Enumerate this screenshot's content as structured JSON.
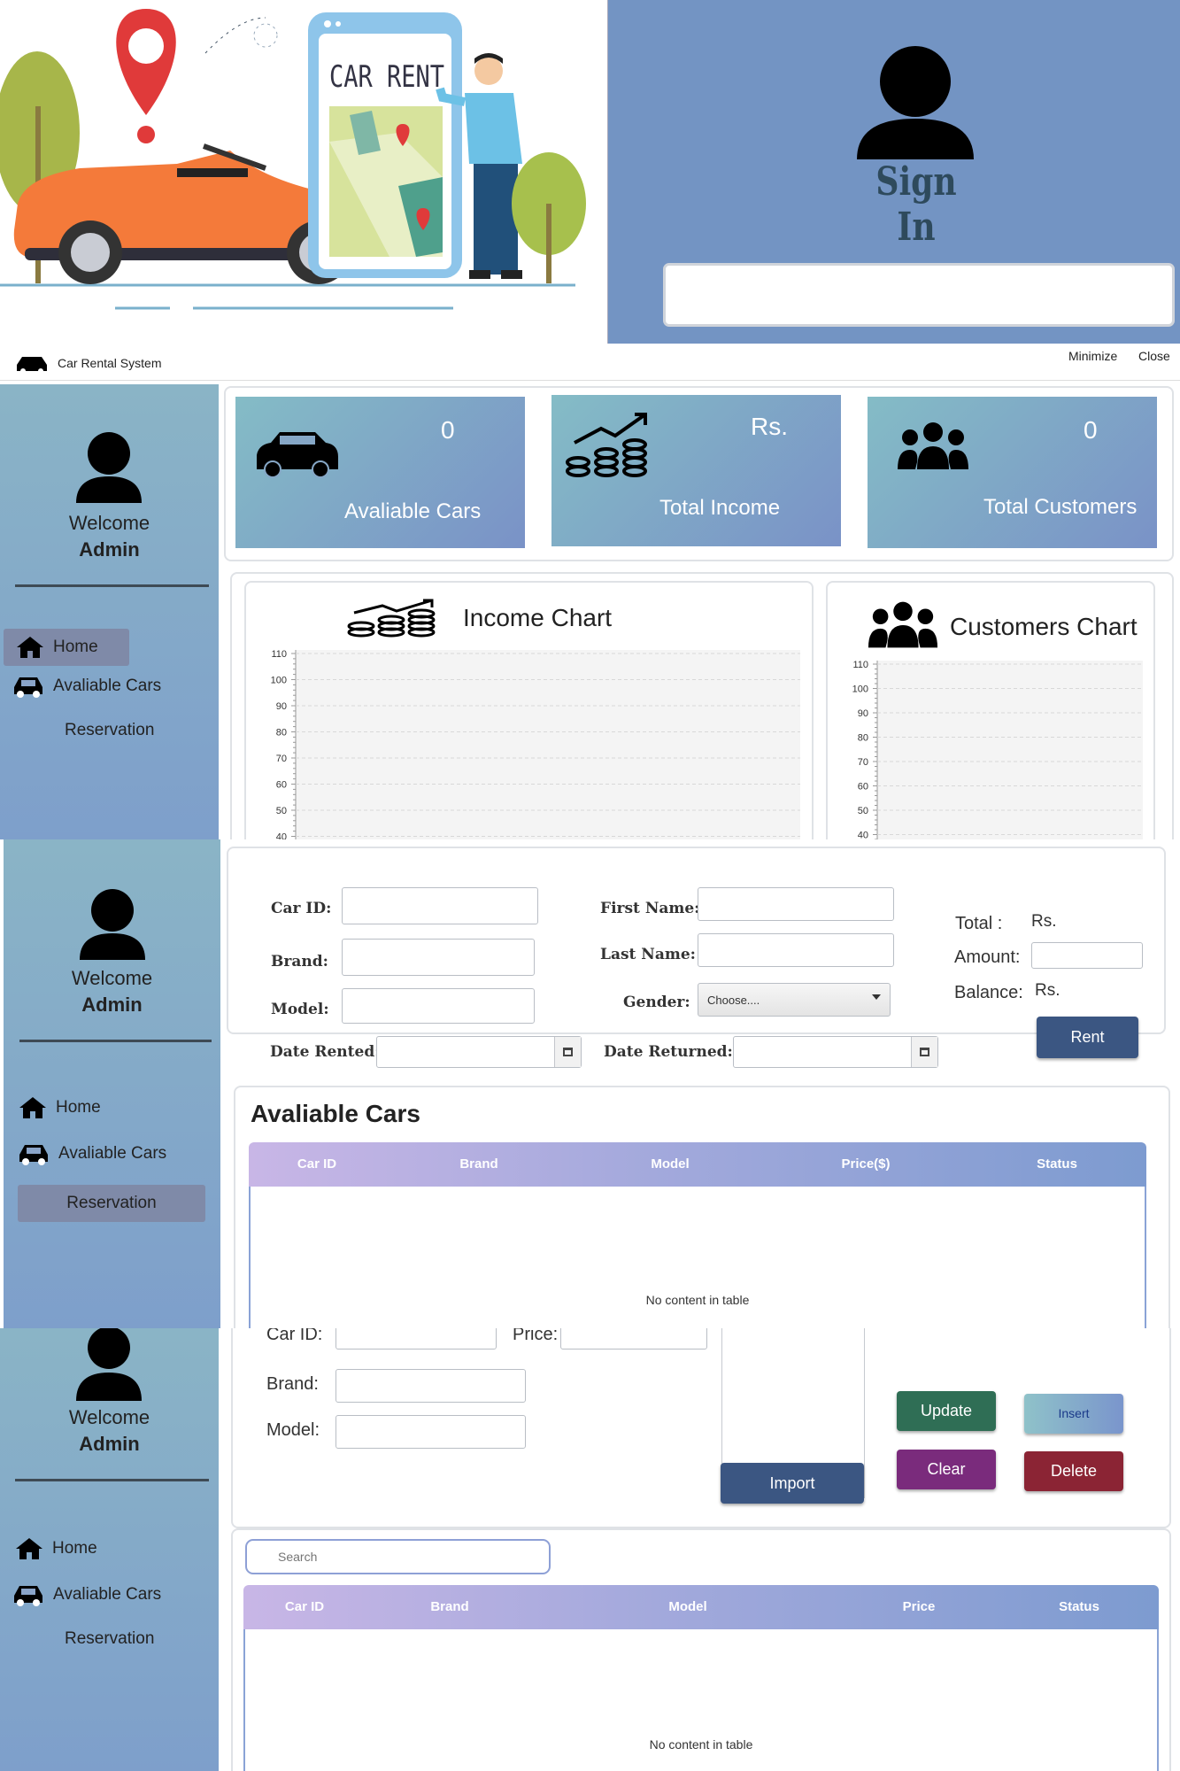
{
  "signin": {
    "title": "Sign In"
  },
  "hero": {
    "phone_label": "CAR RENT"
  },
  "window": {
    "title": "Car Rental System",
    "minimize": "Minimize",
    "close": "Close"
  },
  "sidebar": {
    "welcome": "Welcome",
    "user": "Admin",
    "items": [
      "Home",
      "Avaliable Cars",
      "Reservation"
    ]
  },
  "dashboard": {
    "cards": [
      {
        "value": "0",
        "label": "Avaliable Cars",
        "icon": "car-icon"
      },
      {
        "value": "Rs.",
        "label": "Total Income",
        "icon": "coins-growth-icon"
      },
      {
        "value": "0",
        "label": "Total Customers",
        "icon": "users-icon"
      }
    ],
    "income_chart": {
      "title": "Income Chart"
    },
    "customers_chart": {
      "title": "Customers Chart"
    }
  },
  "chart_data": [
    {
      "type": "bar",
      "title": "Income Chart",
      "categories": [],
      "values": [],
      "yticks": [
        "110",
        "100",
        "90",
        "80",
        "70",
        "60",
        "50",
        "40"
      ],
      "grid": true
    },
    {
      "type": "bar",
      "title": "Customers Chart",
      "categories": [],
      "values": [],
      "yticks": [
        "110",
        "100",
        "90",
        "80",
        "70",
        "60",
        "50",
        "40"
      ],
      "grid": true
    }
  ],
  "rent_form": {
    "car_id": "Car ID:",
    "brand": "Brand:",
    "model": "Model:",
    "date_rented": "Date Rented:",
    "first_name": "First Name:",
    "last_name": "Last Name:",
    "gender": "Gender:",
    "gender_value": "Choose....",
    "date_returned": "Date Returned:",
    "total": "Total :",
    "total_value": "Rs.",
    "amount": "Amount:",
    "balance": "Balance:",
    "balance_value": "Rs.",
    "rent_button": "Rent"
  },
  "available_cars": {
    "title": "Avaliable Cars",
    "columns": [
      "Car ID",
      "Brand",
      "Model",
      "Price($)",
      "Status"
    ],
    "empty": "No content in table"
  },
  "car_form": {
    "car_id": "Car ID:",
    "price": "Price:",
    "brand": "Brand:",
    "model": "Model:",
    "import": "Import",
    "update": "Update",
    "insert": "Insert",
    "clear": "Clear",
    "delete": "Delete",
    "search_placeholder": "Search"
  },
  "cars_table": {
    "columns": [
      "Car ID",
      "Brand",
      "Model",
      "Price",
      "Status"
    ],
    "empty": "No content in table"
  },
  "colors": {
    "sidebar": "#7e9fcb",
    "signin_panel": "#7394c3",
    "rent_button": "#3b5682",
    "update": "#2f6e55",
    "clear": "#7a2b7c",
    "delete": "#8b2434",
    "import": "#3b5682"
  }
}
